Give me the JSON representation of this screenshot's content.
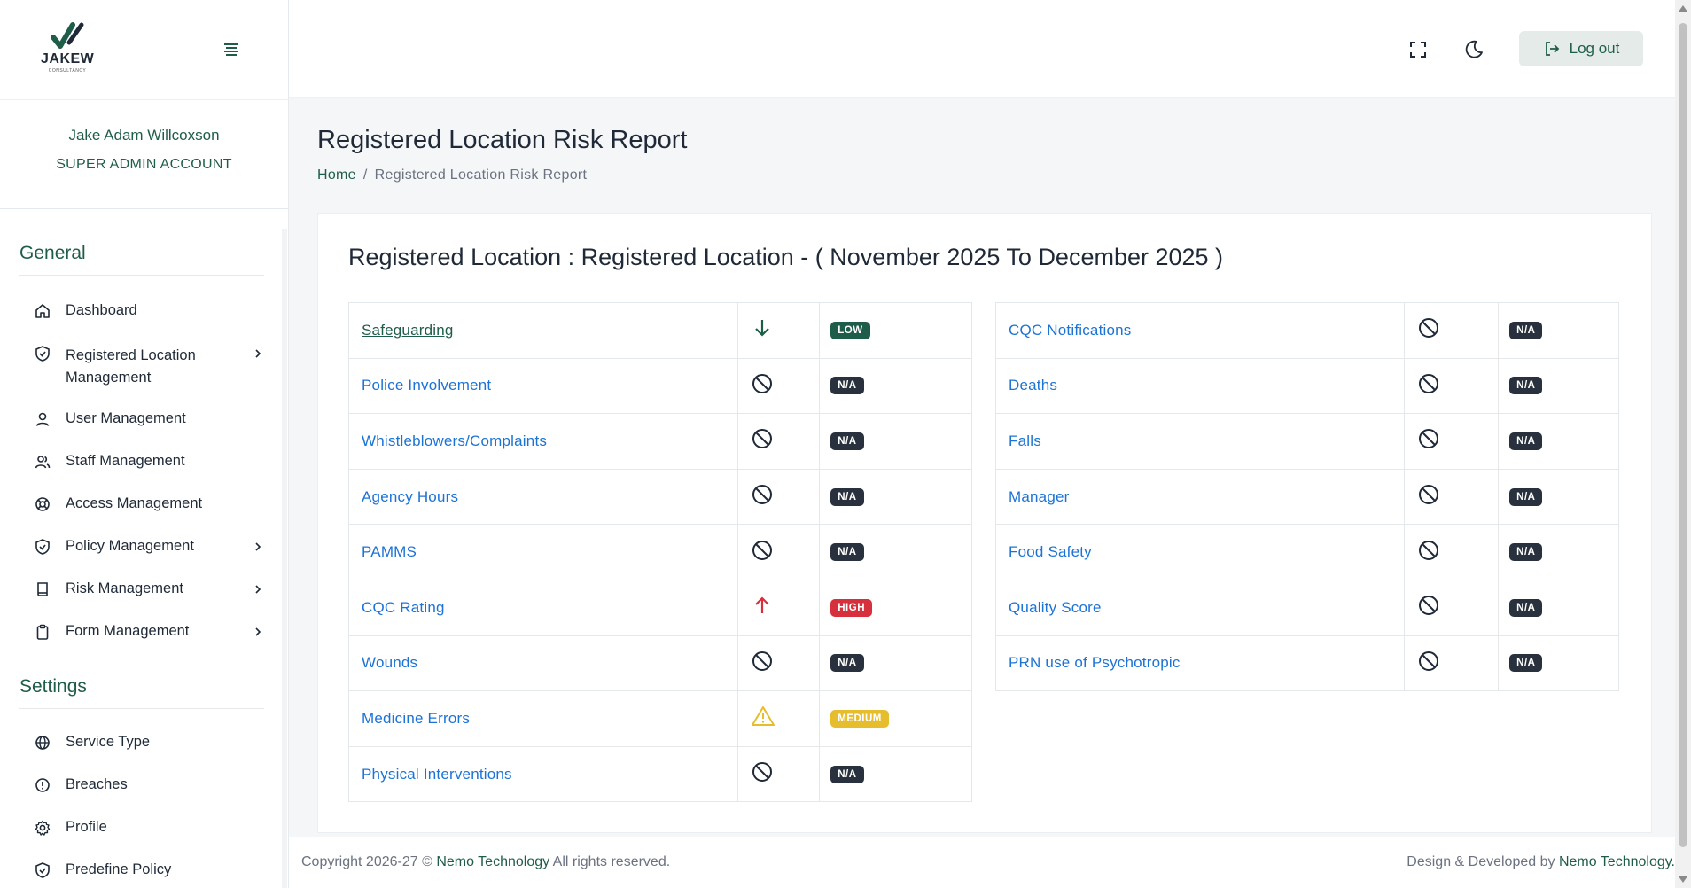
{
  "brand": {
    "logo_text": "JAKEW",
    "logo_sub": "CONSULTANCY"
  },
  "user": {
    "name": "Jake Adam Willcoxson",
    "role": "SUPER ADMIN ACCOUNT"
  },
  "sidebar": {
    "general_title": "General",
    "settings_title": "Settings",
    "general_items": [
      {
        "label": "Dashboard",
        "icon": "home-icon"
      },
      {
        "label": "Registered Location Management",
        "icon": "shield-check-icon",
        "has_submenu": true
      },
      {
        "label": "User Management",
        "icon": "user-icon"
      },
      {
        "label": "Staff Management",
        "icon": "users-icon"
      },
      {
        "label": "Access Management",
        "icon": "lifebuoy-icon"
      },
      {
        "label": "Policy Management",
        "icon": "shield-check-icon",
        "has_submenu": true
      },
      {
        "label": "Risk Management",
        "icon": "book-icon",
        "has_submenu": true
      },
      {
        "label": "Form Management",
        "icon": "clipboard-icon",
        "has_submenu": true
      }
    ],
    "settings_items": [
      {
        "label": "Service Type",
        "icon": "globe-icon"
      },
      {
        "label": "Breaches",
        "icon": "alert-circle-icon"
      },
      {
        "label": "Profile",
        "icon": "gear-icon"
      },
      {
        "label": "Predefine Policy",
        "icon": "shield-check-icon"
      }
    ]
  },
  "topbar": {
    "logout_label": "Log out"
  },
  "page": {
    "title": "Registered Location Risk Report",
    "breadcrumb_home": "Home",
    "breadcrumb_sep": "/",
    "breadcrumb_current": "Registered Location Risk Report"
  },
  "report": {
    "heading": "Registered Location : Registered Location - ( November 2025 To December 2025 )",
    "left_rows": [
      {
        "name": "Safeguarding",
        "icon": "arrow-down-icon",
        "badge": "LOW",
        "level": "low"
      },
      {
        "name": "Police Involvement",
        "icon": "ban-icon",
        "badge": "N/A",
        "level": "na"
      },
      {
        "name": "Whistleblowers/Complaints",
        "icon": "ban-icon",
        "badge": "N/A",
        "level": "na"
      },
      {
        "name": "Agency Hours",
        "icon": "ban-icon",
        "badge": "N/A",
        "level": "na"
      },
      {
        "name": "PAMMS",
        "icon": "ban-icon",
        "badge": "N/A",
        "level": "na"
      },
      {
        "name": "CQC Rating",
        "icon": "arrow-up-icon",
        "badge": "HIGH",
        "level": "high"
      },
      {
        "name": "Wounds",
        "icon": "ban-icon",
        "badge": "N/A",
        "level": "na"
      },
      {
        "name": "Medicine Errors",
        "icon": "warning-icon",
        "badge": "MEDIUM",
        "level": "medium"
      },
      {
        "name": "Physical Interventions",
        "icon": "ban-icon",
        "badge": "N/A",
        "level": "na"
      }
    ],
    "right_rows": [
      {
        "name": "CQC Notifications",
        "icon": "ban-icon",
        "badge": "N/A",
        "level": "na"
      },
      {
        "name": "Deaths",
        "icon": "ban-icon",
        "badge": "N/A",
        "level": "na"
      },
      {
        "name": "Falls",
        "icon": "ban-icon",
        "badge": "N/A",
        "level": "na"
      },
      {
        "name": "Manager",
        "icon": "ban-icon",
        "badge": "N/A",
        "level": "na"
      },
      {
        "name": "Food Safety",
        "icon": "ban-icon",
        "badge": "N/A",
        "level": "na"
      },
      {
        "name": "Quality Score",
        "icon": "ban-icon",
        "badge": "N/A",
        "level": "na"
      },
      {
        "name": "PRN use of Psychotropic",
        "icon": "ban-icon",
        "badge": "N/A",
        "level": "na"
      }
    ]
  },
  "footer": {
    "copyright_prefix": "Copyright 2026-27 ©",
    "company": "Nemo Technology",
    "copyright_suffix": "All rights reserved.",
    "credit_prefix": "Design & Developed by",
    "credit_company": "Nemo Technology."
  },
  "colors": {
    "brand_green": "#1f5d4b",
    "link_blue": "#1c73d6",
    "na": "#28313d",
    "low": "#1f5d4b",
    "high": "#d6303d",
    "medium": "#e6bd2d"
  }
}
